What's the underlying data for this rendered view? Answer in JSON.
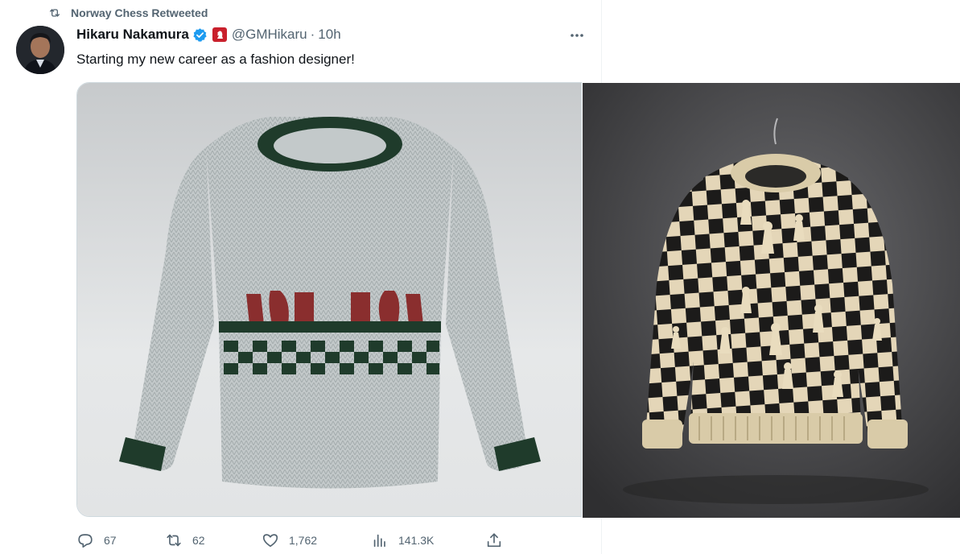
{
  "retweet": {
    "icon": "retweet-icon",
    "label": "Norway Chess Retweeted"
  },
  "author": {
    "display_name": "Hikaru Nakamura",
    "verified_icon": "verified-badge-icon",
    "affiliation_icon": "affiliate-badge-icon",
    "handle": "@GMHikaru",
    "separator": "·",
    "time": "10h"
  },
  "more_icon": "more-icon",
  "tweet": {
    "text": "Starting my new career as a fashion designer!"
  },
  "media": [
    {
      "name": "sweater-green-render",
      "colors": [
        "#dfe3e4",
        "#1e3d2c",
        "#8a2e2e"
      ]
    },
    {
      "name": "sweater-chess-checkered",
      "colors": [
        "#555558",
        "#1c1b1a",
        "#e4d6b8"
      ]
    }
  ],
  "actions": {
    "reply": {
      "icon": "reply-icon",
      "count": "67"
    },
    "retweet": {
      "icon": "retweet-icon",
      "count": "62"
    },
    "like": {
      "icon": "heart-icon",
      "count": "1,762"
    },
    "views": {
      "icon": "views-icon",
      "count": "141.3K"
    },
    "share": {
      "icon": "share-icon"
    }
  }
}
